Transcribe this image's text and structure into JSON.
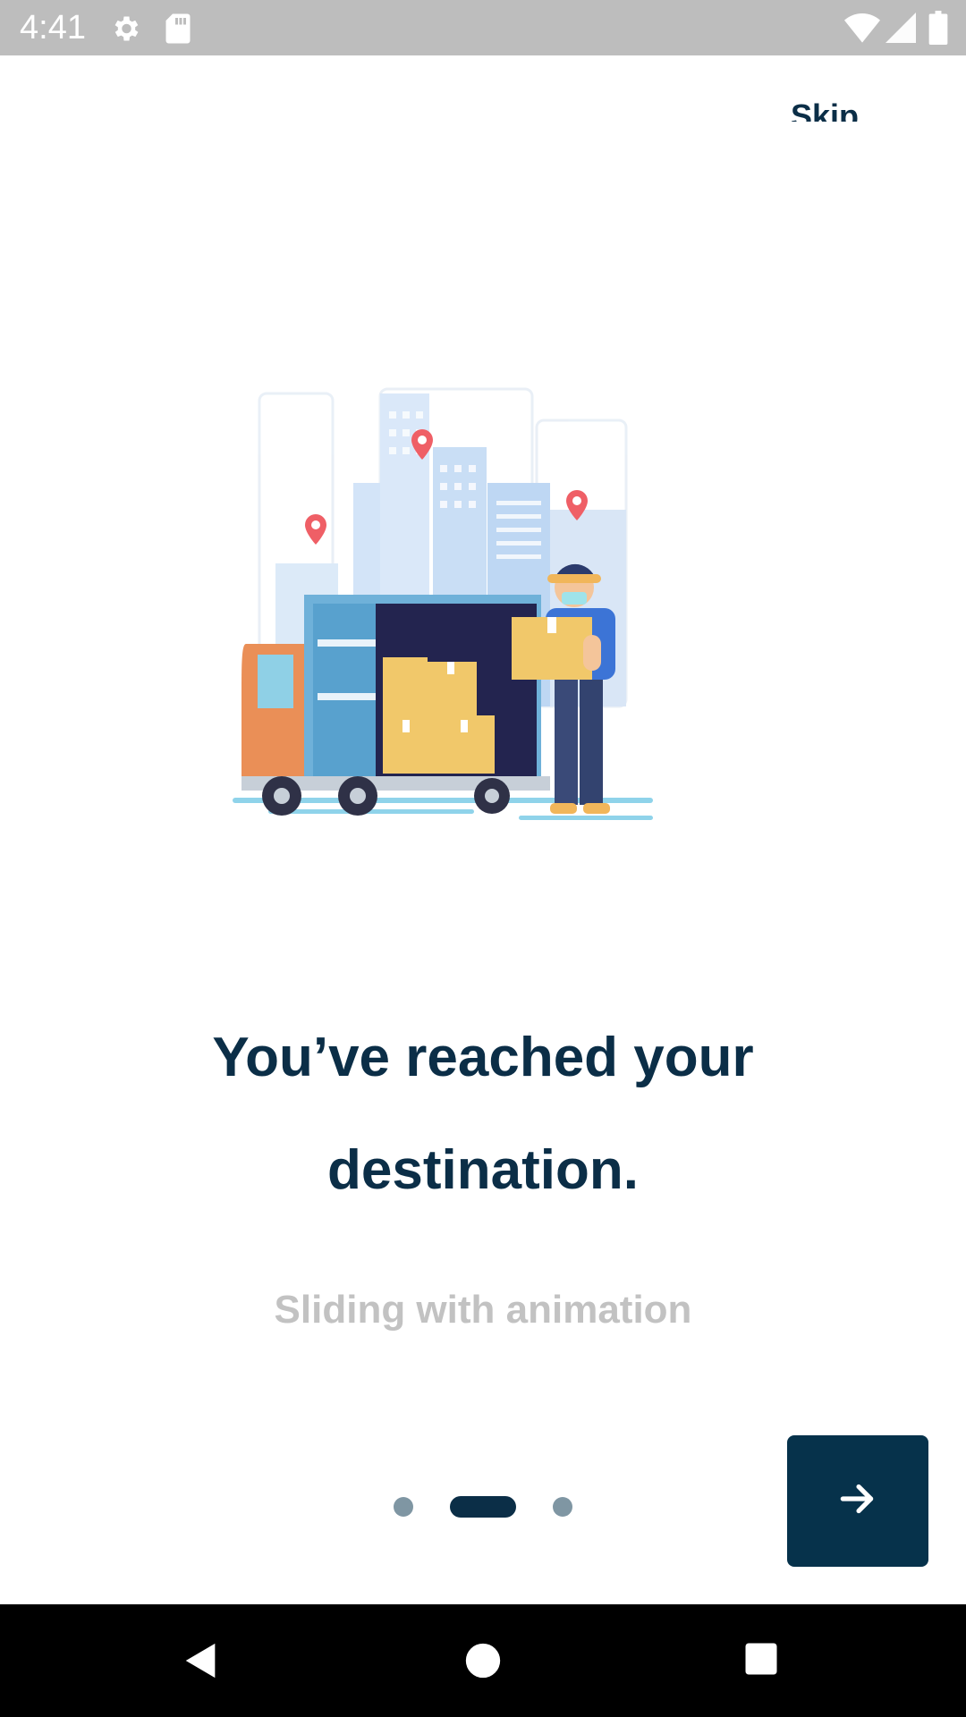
{
  "status_bar": {
    "time": "4:41",
    "left_icons": [
      "gear-icon",
      "sd-card-icon"
    ],
    "right_icons": [
      "wifi-icon",
      "signal-icon",
      "battery-icon"
    ],
    "background": "#bdbdbd"
  },
  "onboarding": {
    "skip_label": "Skip",
    "title": "You’ve reached your destination.",
    "subtitle": "Sliding with animation",
    "page_count": 3,
    "active_page": 2,
    "next_button_icon": "arrow-right-icon",
    "illustration": "delivery-truck-courier-illustration"
  },
  "colors": {
    "primary": "#0b2e47",
    "button": "#06324b",
    "subtitle": "#c2c2c2",
    "inactive_dot": "#7f96a3"
  },
  "navigation_bar": {
    "buttons": [
      "back-icon",
      "home-icon",
      "recents-icon"
    ]
  }
}
